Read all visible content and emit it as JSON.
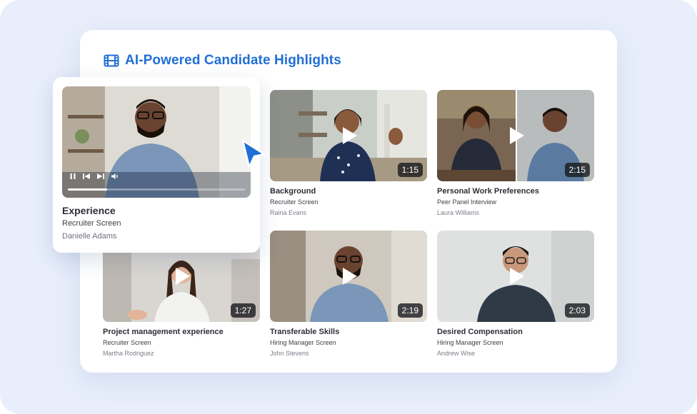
{
  "header": {
    "title": "AI-Powered Candidate Highlights",
    "icon": "film-icon",
    "accent": "#1f6fd6"
  },
  "featured": {
    "title": "Experience",
    "interview_type": "Recruiter Screen",
    "candidate": "Danielle Adams",
    "progress": 0.22,
    "controls": [
      "pause-icon",
      "skip-back-icon",
      "skip-forward-icon",
      "volume-icon"
    ]
  },
  "videos": [
    {
      "title": "Background",
      "interview_type": "Recruiter Screen",
      "candidate": "Raina Evans",
      "duration": "1:15"
    },
    {
      "title": "Personal Work Preferences",
      "interview_type": "Peer Panel Interview",
      "candidate": "Laura Williams",
      "duration": "2:15"
    },
    {
      "title": "Project management experience",
      "interview_type": "Recruiter Screen",
      "candidate": "Martha Rodriguez",
      "duration": "1:27"
    },
    {
      "title": "Transferable Skills",
      "interview_type": "Hiring Manager Screen",
      "candidate": "John Stevens",
      "duration": "2:19"
    },
    {
      "title": "Desired Compensation",
      "interview_type": "Hiring Manager Screen",
      "candidate": "Andrew Wise",
      "duration": "2:03"
    }
  ]
}
